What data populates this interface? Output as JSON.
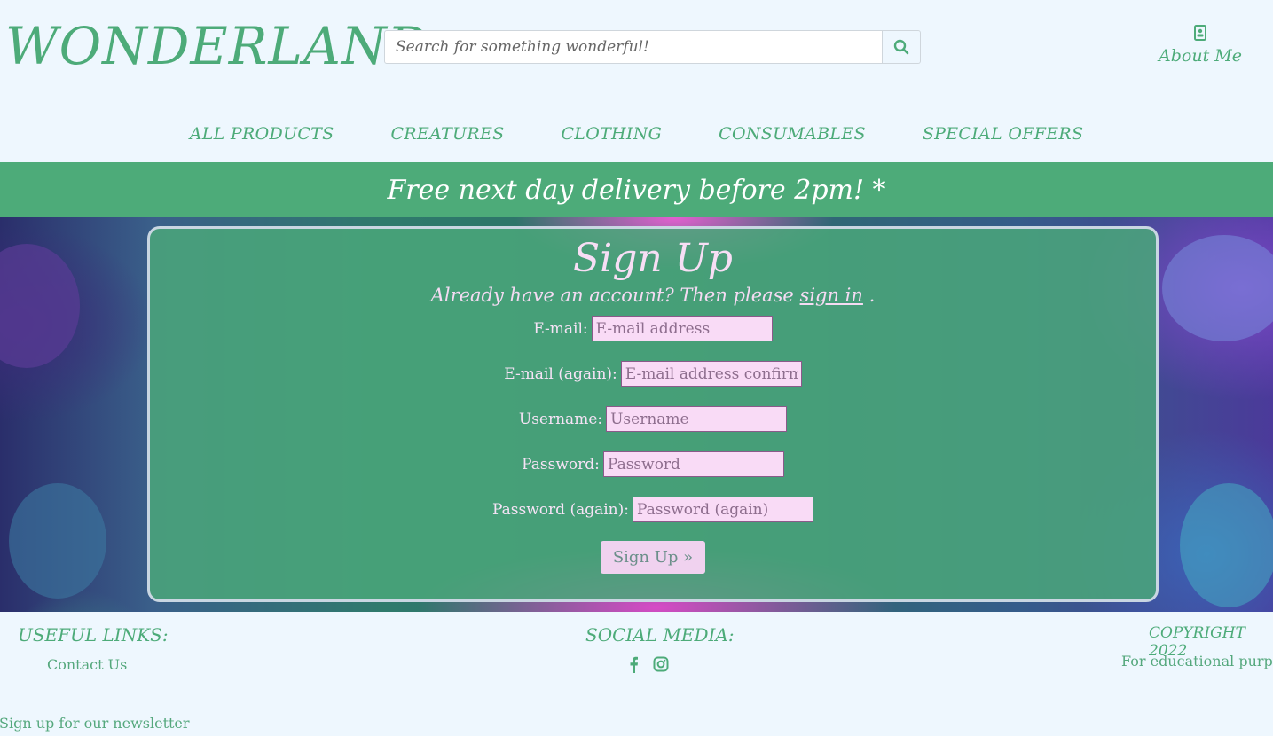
{
  "header": {
    "logo": "WONDERLAND",
    "search_placeholder": "Search for something wonderful!",
    "about_label": "About Me"
  },
  "nav": [
    "ALL PRODUCTS",
    "CREATURES",
    "CLOTHING",
    "CONSUMABLES",
    "SPECIAL OFFERS"
  ],
  "banner": {
    "text": "Free next day delivery before 2pm! *"
  },
  "signup": {
    "title": "Sign Up",
    "subtitle_prefix": "Already have an account? Then please",
    "signin_link": "sign in",
    "subtitle_suffix": ".",
    "fields": [
      {
        "label": "E-mail:",
        "placeholder": "E-mail address"
      },
      {
        "label": "E-mail (again):",
        "placeholder": "E-mail address confirmation"
      },
      {
        "label": "Username:",
        "placeholder": "Username"
      },
      {
        "label": "Password:",
        "placeholder": "Password"
      },
      {
        "label": "Password (again):",
        "placeholder": "Password (again)"
      }
    ],
    "button_label": "Sign Up »"
  },
  "footer": {
    "useful_links_heading": "USEFUL LINKS:",
    "contact_link": "Contact Us",
    "social_heading": "SOCIAL MEDIA:",
    "social_icons": [
      "facebook-icon",
      "instagram-icon"
    ],
    "copyright_heading": "COPYRIGHT 2022",
    "copyright_text": "For educational purposes",
    "newsletter": "Sign up for our newsletter"
  },
  "colors": {
    "accent": "#4dab79",
    "background": "#eef7fe",
    "form_input": "#f9dbf6"
  }
}
